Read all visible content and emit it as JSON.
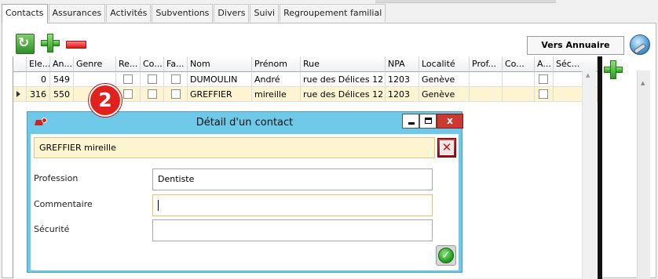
{
  "tabs": [
    {
      "label": "Contacts"
    },
    {
      "label": "Assurances"
    },
    {
      "label": "Activités"
    },
    {
      "label": "Subventions"
    },
    {
      "label": "Divers"
    },
    {
      "label": "Suivi"
    },
    {
      "label": "Regroupement familial"
    }
  ],
  "toolbar": {
    "vers_annuaire_label": "Vers Annuaire"
  },
  "grid": {
    "columns": [
      "Ele...",
      "An...",
      "Genre",
      "Re...",
      "Co...",
      "Fa...",
      "Nom",
      "Prénom",
      "Rue",
      "NPA",
      "Localité",
      "Prof...",
      "Co...",
      "A...",
      "Séc..."
    ],
    "rows": [
      {
        "ele": "0",
        "an": "549",
        "genre": "",
        "nom": "DUMOULIN",
        "prenom": "André",
        "rue": "rue des Délices 12",
        "npa": "1203",
        "localite": "Genève",
        "prof": "",
        "co": "",
        "sec": ""
      },
      {
        "ele": "316",
        "an": "550",
        "genre": "",
        "nom": "GREFFIER",
        "prenom": "mireille",
        "rue": "rue des Délices 12",
        "npa": "1203",
        "localite": "Genève",
        "prof": "",
        "co": "",
        "sec": ""
      }
    ]
  },
  "callout": {
    "number": "2"
  },
  "dialog": {
    "title": "Détail d'un contact",
    "close_glyph": "x",
    "contact_name": "GREFFIER mireille",
    "fields": [
      {
        "label": "Profession",
        "value": "Dentiste"
      },
      {
        "label": "Commentaire",
        "value": ""
      },
      {
        "label": "Sécurité",
        "value": ""
      }
    ]
  },
  "icons": {
    "refresh": "refresh-icon",
    "add": "plus-icon",
    "remove": "minus-icon",
    "globe": "globe-icon",
    "cancel": "cancel-x-icon",
    "ok": "checkmark-icon"
  },
  "colors": {
    "dialog_frame": "#6ec8e8",
    "selected_row": "#fdf5d2",
    "callout": "#e0211e",
    "add_green": "#2c9a20",
    "remove_red": "#d61e1e"
  }
}
